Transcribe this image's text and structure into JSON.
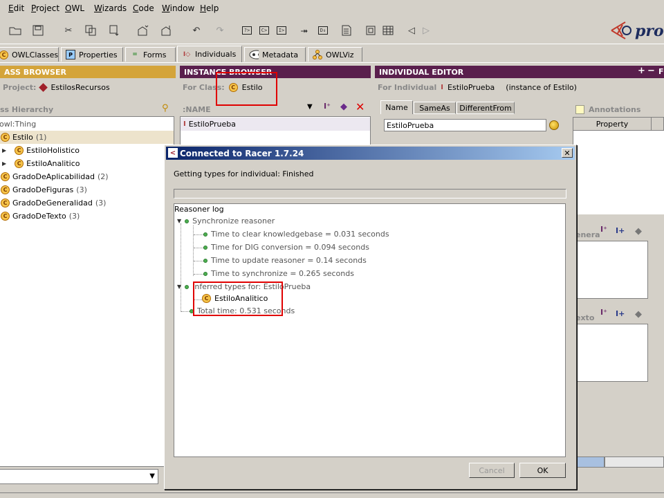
{
  "menu": [
    "Edit",
    "Project",
    "OWL",
    "Wizards",
    "Code",
    "Window",
    "Help"
  ],
  "logo": {
    "text": "protē"
  },
  "tabs": [
    {
      "label": "OWLClasses",
      "icon": "owl-classes-icon"
    },
    {
      "label": "Properties",
      "icon": "properties-icon"
    },
    {
      "label": "Forms",
      "icon": "forms-icon"
    },
    {
      "label": "Individuals",
      "icon": "individuals-icon",
      "active": true
    },
    {
      "label": "Metadata",
      "icon": "metadata-icon"
    },
    {
      "label": "OWLViz",
      "icon": "owlviz-icon"
    }
  ],
  "class_browser": {
    "header": "ASS BROWSER",
    "project_label": "Project:",
    "project_name": "EstilosRecursos",
    "hierarchy_label": "ss Hierarchy",
    "root": "owl:Thing",
    "items": [
      {
        "name": "Estilo",
        "count": "(1)",
        "level": 0,
        "selected": true
      },
      {
        "name": "EstiloHolistico",
        "count": "",
        "level": 1,
        "expander": true
      },
      {
        "name": "EstiloAnalitico",
        "count": "",
        "level": 1,
        "expander": true
      },
      {
        "name": "GradoDeAplicabilidad",
        "count": "(2)",
        "level": 0
      },
      {
        "name": "GradoDeFiguras",
        "count": "(3)",
        "level": 0
      },
      {
        "name": "GradoDeGeneralidad",
        "count": "(3)",
        "level": 0
      },
      {
        "name": "GradoDeTexto",
        "count": "(3)",
        "level": 0
      }
    ]
  },
  "instance_browser": {
    "header": "INSTANCE BROWSER",
    "for_class_label": "For Class:",
    "class_name": "Estilo",
    "column_label": ":NAME",
    "instance": "EstiloPrueba"
  },
  "individual_editor": {
    "header": "INDIVIDUAL EDITOR",
    "for_label": "For Individual",
    "name": "EstiloPrueba",
    "instance_of": "(instance of Estilo)",
    "tabs": [
      "Name",
      "SameAs",
      "DifferentFrom"
    ],
    "name_value": "EstiloPrueba",
    "annotations_label": "Annotations",
    "property_col": "Property",
    "gen_label": "enera",
    "texto_label": "exto"
  },
  "dialog": {
    "title": "Connected to Racer 1.7.24",
    "status": "Getting types for individual: Finished",
    "log_title": "Reasoner log",
    "sync": "Synchronize reasoner",
    "sync_items": [
      "Time to clear knowledgebase = 0.031 seconds",
      "Time for DIG conversion = 0.094 seconds",
      "Time to update reasoner = 0.14 seconds",
      "Time to synchronize = 0.265 seconds"
    ],
    "inferred": "Inferred types for: EstiloPrueba",
    "inferred_class": "EstiloAnalitico",
    "total": "Total time: 0.531 seconds",
    "cancel": "Cancel",
    "ok": "OK"
  },
  "colors": {
    "class_header": "#d4a43a",
    "instance_header": "#5a1f4d",
    "selection": "#ede3cc",
    "title_start": "#0a246a",
    "highlight": "#e00000"
  }
}
